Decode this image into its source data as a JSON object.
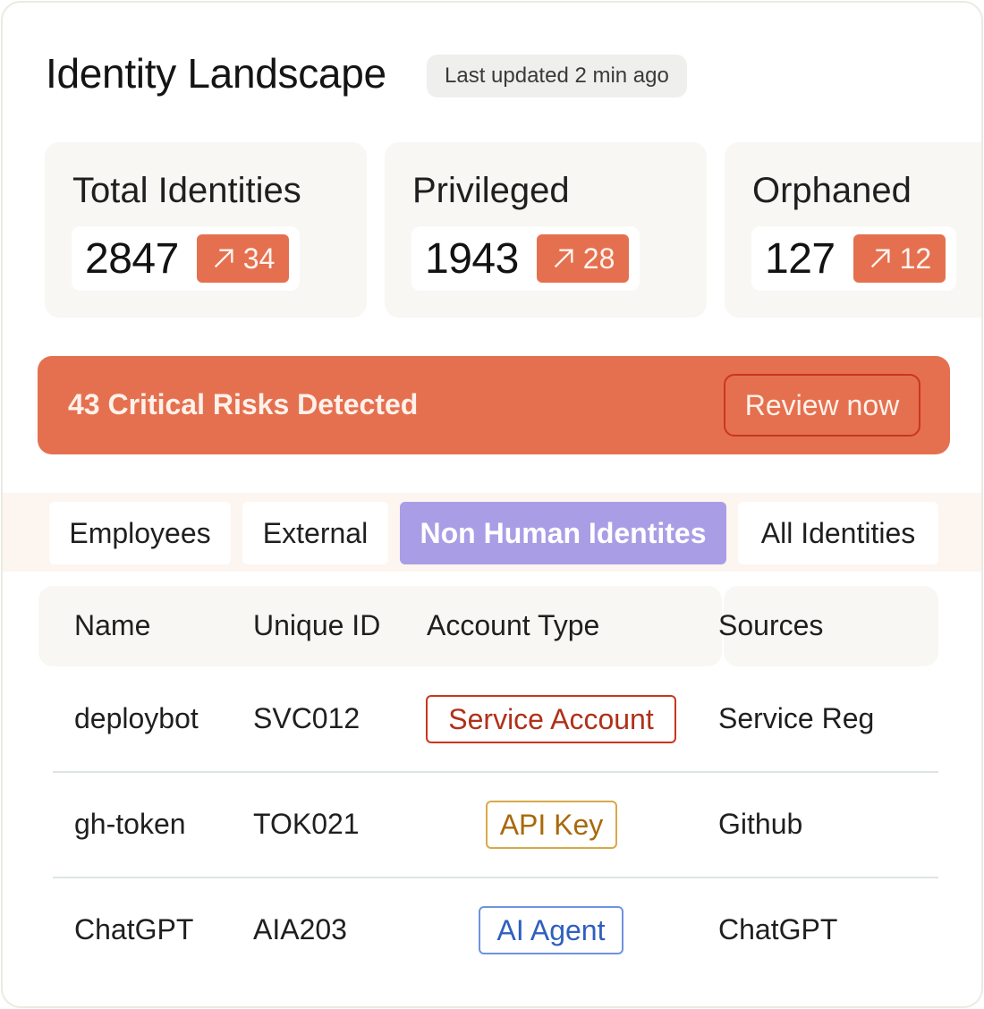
{
  "header": {
    "title": "Identity Landscape",
    "updated": "Last updated 2 min ago"
  },
  "stats": [
    {
      "label": "Total Identities",
      "value": "2847",
      "delta": "34"
    },
    {
      "label": "Privileged",
      "value": "1943",
      "delta": "28"
    },
    {
      "label": "Orphaned",
      "value": "127",
      "delta": "12"
    }
  ],
  "alert": {
    "text": "43 Critical Risks Detected",
    "button": "Review now"
  },
  "tabs": [
    {
      "label": "Employees",
      "active": false
    },
    {
      "label": "External",
      "active": false
    },
    {
      "label": "Non Human Identites",
      "active": true
    },
    {
      "label": "All Identities",
      "active": false
    }
  ],
  "table": {
    "columns": [
      "Name",
      "Unique ID",
      "Account Type",
      "Sources"
    ],
    "rows": [
      {
        "name": "deploybot",
        "id": "SVC012",
        "type": "Service Account",
        "source": "Service Reg"
      },
      {
        "name": "gh-token",
        "id": "TOK021",
        "type": "API Key",
        "source": "Github"
      },
      {
        "name": "ChatGPT",
        "id": "AIA203",
        "type": "AI Agent",
        "source": "ChatGPT"
      }
    ]
  },
  "colors": {
    "accent": "#e5704f",
    "active_tab": "#a99ee6",
    "service_account": "#c9361e",
    "api_key": "#d8a94a",
    "ai_agent": "#3c6fd1"
  },
  "icons": {
    "delta": "arrow-up-right-icon"
  }
}
